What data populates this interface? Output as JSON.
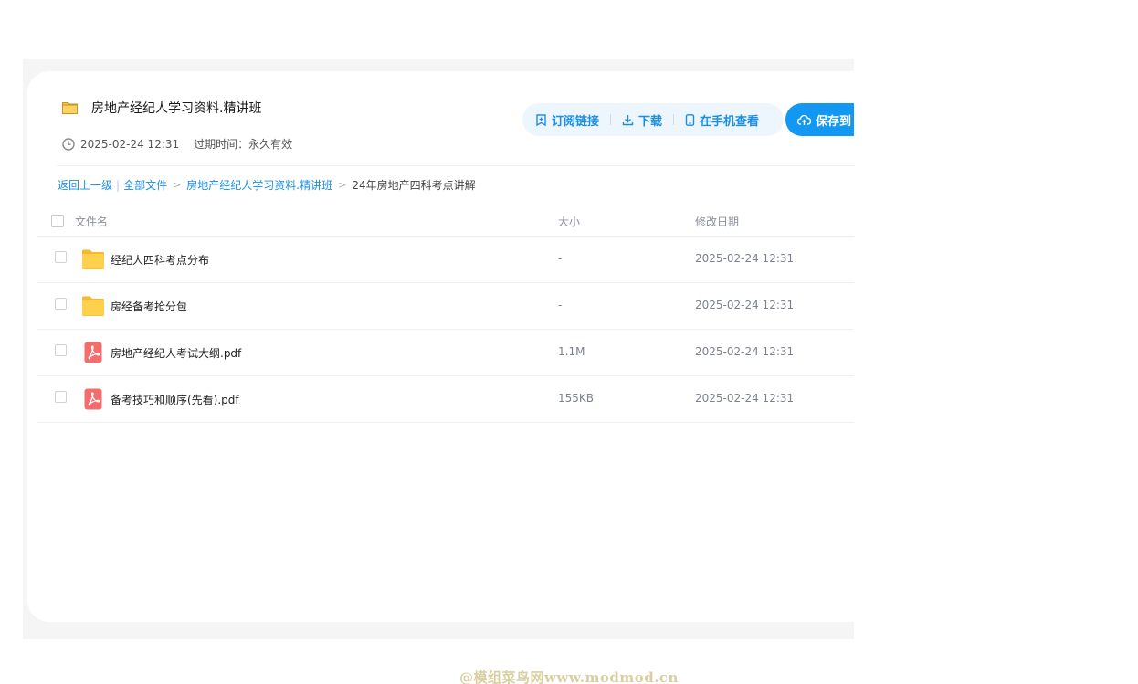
{
  "header": {
    "title": "房地产经纪人学习资料.精讲班",
    "created": "2025-02-24 12:31",
    "expire": "过期时间：永久有效"
  },
  "actions": {
    "subscribe": "订阅链接",
    "download": "下载",
    "view_on_phone": "在手机查看",
    "save": "保存到"
  },
  "breadcrumb": {
    "back": "返回上一级",
    "all_files": "全部文件",
    "folder": "房地产经纪人学习资料.精讲班",
    "current": "24年房地产四科考点讲解"
  },
  "table": {
    "columns": {
      "name": "文件名",
      "size": "大小",
      "date": "修改日期"
    },
    "rows": [
      {
        "name": "经纪人四科考点分布",
        "size": "-",
        "date": "2025-02-24 12:31",
        "type": "folder"
      },
      {
        "name": "房经备考抢分包",
        "size": "-",
        "date": "2025-02-24 12:31",
        "type": "folder"
      },
      {
        "name": "房地产经纪人考试大纲.pdf",
        "size": "1.1M",
        "date": "2025-02-24 12:31",
        "type": "pdf"
      },
      {
        "name": "备考技巧和顺序(先看).pdf",
        "size": "155KB",
        "date": "2025-02-24 12:31",
        "type": "pdf"
      }
    ]
  },
  "watermark": "@模组菜鸟网www.modmod.cn",
  "colors": {
    "accent": "#1298f2",
    "link": "#1a8ee6",
    "folder": "#ffc53d",
    "pdf": "#f56c6c"
  }
}
